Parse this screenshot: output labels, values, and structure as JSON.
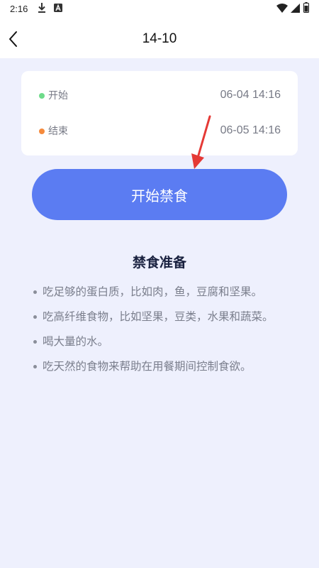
{
  "status_bar": {
    "time": "2:16",
    "icons": [
      "download-icon",
      "notification-a-icon",
      "wifi-icon",
      "signal-icon",
      "battery-icon"
    ]
  },
  "header": {
    "title": "14-10",
    "back_icon": "chevron-left-icon"
  },
  "time_card": {
    "start": {
      "label": "开始",
      "value": "06-04 14:16",
      "dot_color": "#6edb8a"
    },
    "end": {
      "label": "结束",
      "value": "06-05 14:16",
      "dot_color": "#f58a3c"
    }
  },
  "start_button": {
    "label": "开始禁食",
    "color": "#5b7cf2"
  },
  "preparation": {
    "title": "禁食准备",
    "items": [
      "吃足够的蛋白质，比如肉，鱼，豆腐和坚果。",
      "吃高纤维食物，比如坚果，豆类，水果和蔬菜。",
      "喝大量的水。",
      "吃天然的食物来帮助在用餐期间控制食欲。"
    ]
  },
  "colors": {
    "background": "#eef0fd",
    "annotation_arrow": "#e53935"
  }
}
